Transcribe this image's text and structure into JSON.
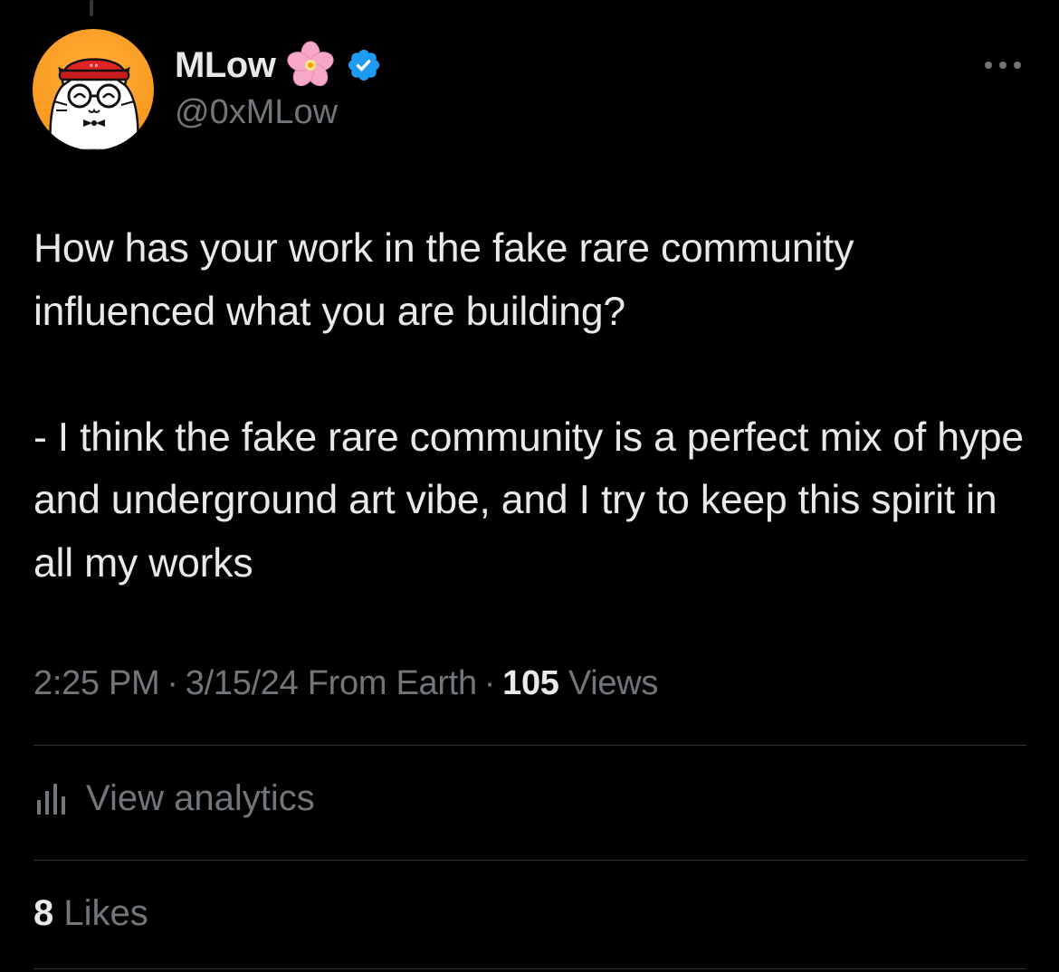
{
  "author": {
    "display_name": "MLow",
    "handle": "@0xMLow",
    "flower_emoji_icon": "cherry-blossom-icon",
    "verified_icon": "verified-badge-icon",
    "badge_color": "#1d9bf0"
  },
  "tweet": {
    "paragraph_1": "How has your work in the fake rare community influenced what you are building?",
    "paragraph_2": "- I think the fake rare community is a perfect mix of hype and underground art vibe, and I try to keep this spirit in all my works"
  },
  "meta": {
    "time": "2:25 PM",
    "separator": "·",
    "date": "3/15/24",
    "source": "From Earth",
    "views_count": "105",
    "views_label": "Views"
  },
  "analytics": {
    "label": "View analytics",
    "icon": "analytics-bars-icon"
  },
  "likes": {
    "count": "8",
    "label": "Likes"
  },
  "colors": {
    "background": "#000000",
    "primary_text": "#e7e9ea",
    "secondary_text": "#71767b",
    "divider": "#2f3336",
    "avatar_orange": "#f7931a"
  }
}
